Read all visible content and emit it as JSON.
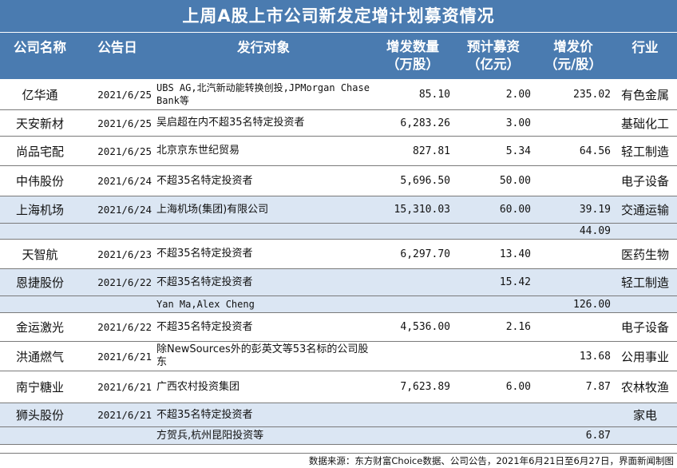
{
  "title": "上周A股上市公司新发定增计划募资情况",
  "headers": {
    "company": "公司名称",
    "date": "公告日",
    "target": "发行对象",
    "qty_line1": "增发数量",
    "qty_line2": "（万股）",
    "fund_line1": "预计募资",
    "fund_line2": "（亿元）",
    "price_line1": "增发价",
    "price_line2": "（元/股）",
    "industry": "行业"
  },
  "rows": [
    {
      "company": "亿华通",
      "date": "2021/6/25",
      "target": "UBS AG,北汽新动能转换创投,JPMorgan Chase Bank等",
      "qty": "85.10",
      "fund": "2.00",
      "price": "235.02",
      "industry": "有色金属"
    },
    {
      "company": "天安新材",
      "date": "2021/6/25",
      "target": "吴启超在内不超35名特定投资者",
      "qty": "6,283.26",
      "fund": "3.00",
      "price": "",
      "industry": "基础化工"
    },
    {
      "company": "尚品宅配",
      "date": "2021/6/25",
      "target": "北京京东世纪贸易",
      "qty": "827.81",
      "fund": "5.34",
      "price": "64.56",
      "industry": "轻工制造"
    },
    {
      "company": "中伟股份",
      "date": "2021/6/24",
      "target": "不超35名特定投资者",
      "qty": "5,696.50",
      "fund": "50.00",
      "price": "",
      "industry": "电子设备"
    },
    {
      "company": "上海机场",
      "date": "2021/6/24",
      "target": "上海机场(集团)有限公司",
      "qty": "15,310.03",
      "fund": "60.00",
      "price": "39.19",
      "industry": "交通运输"
    },
    {
      "company": "",
      "date": "",
      "target": "",
      "qty": "",
      "fund": "",
      "price": "44.09",
      "industry": ""
    },
    {
      "company": "天智航",
      "date": "2021/6/23",
      "target": "不超35名特定投资者",
      "qty": "6,297.70",
      "fund": "13.40",
      "price": "",
      "industry": "医药生物"
    },
    {
      "company": "恩捷股份",
      "date": "2021/6/22",
      "target": "不超35名特定投资者",
      "qty": "",
      "fund": "15.42",
      "price": "",
      "industry": "轻工制造"
    },
    {
      "company": "",
      "date": "",
      "target": "Yan Ma,Alex Cheng",
      "qty": "",
      "fund": "",
      "price": "126.00",
      "industry": ""
    },
    {
      "company": "金运激光",
      "date": "2021/6/22",
      "target": "不超35名特定投资者",
      "qty": "4,536.00",
      "fund": "2.16",
      "price": "",
      "industry": "电子设备"
    },
    {
      "company": "洪通燃气",
      "date": "2021/6/21",
      "target": "除NewSources外的彭英文等53名标的公司股东",
      "qty": "",
      "fund": "",
      "price": "13.68",
      "industry": "公用事业"
    },
    {
      "company": "南宁糖业",
      "date": "2021/6/21",
      "target": "广西农村投资集团",
      "qty": "7,623.89",
      "fund": "6.00",
      "price": "7.87",
      "industry": "农林牧渔"
    },
    {
      "company": "狮头股份",
      "date": "2021/6/21",
      "target": "不超35名特定投资者",
      "qty": "",
      "fund": "",
      "price": "",
      "industry": "家电"
    },
    {
      "company": "",
      "date": "",
      "target": "方贺兵,杭州昆阳投资等",
      "qty": "",
      "fund": "",
      "price": "6.87",
      "industry": ""
    }
  ],
  "footer": "数据来源：东方财富Choice数据、公司公告，2021年6月21日至6月27日，界面新闻制图"
}
